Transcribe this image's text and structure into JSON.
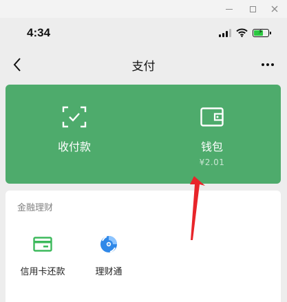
{
  "status_bar": {
    "time": "4:34"
  },
  "nav": {
    "title": "支付"
  },
  "green_card": {
    "collect": {
      "label": "收付款"
    },
    "wallet": {
      "label": "钱包",
      "balance": "¥2.01"
    }
  },
  "finance": {
    "title": "金融理财",
    "items": [
      {
        "label": "信用卡还款",
        "icon": "credit-card-icon"
      },
      {
        "label": "理财通",
        "icon": "licaitong-icon"
      }
    ]
  },
  "colors": {
    "card_green": "#4eab6c",
    "annotation_red": "#e8252a",
    "icon_green": "#3cb95b",
    "icon_blue": "#2f88e8"
  },
  "icons": {
    "window": [
      "minimize-icon",
      "maximize-icon",
      "close-icon"
    ],
    "status": [
      "signal-icon",
      "wifi-icon",
      "battery-icon"
    ],
    "nav": [
      "back-chevron-icon",
      "more-icon"
    ],
    "card": [
      "scan-check-icon",
      "wallet-icon"
    ]
  }
}
